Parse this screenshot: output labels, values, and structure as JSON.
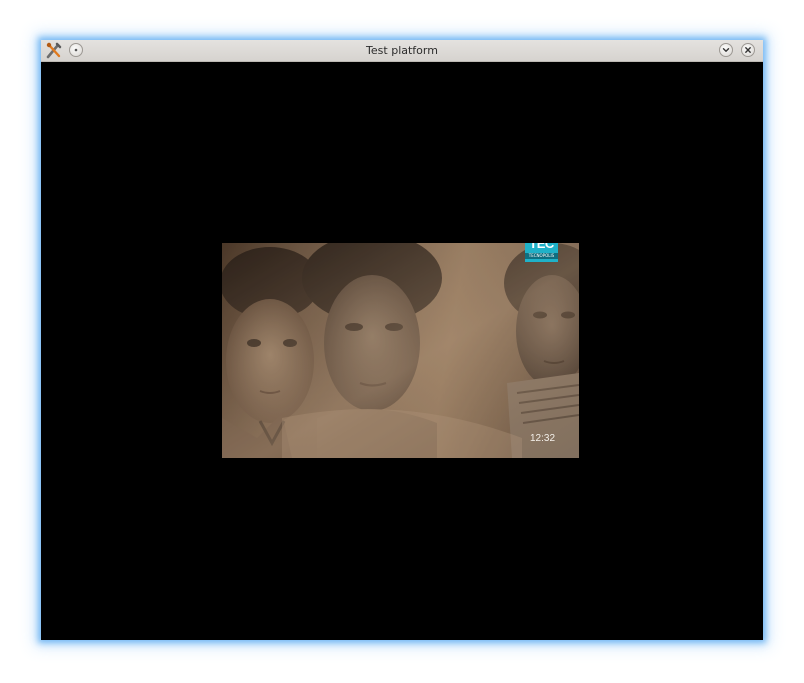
{
  "window": {
    "title": "Test platform"
  },
  "titlebar": {
    "app_icon": "tools-icon",
    "menu_button_icon": "dot-icon",
    "minimize_button_icon": "chevron-down-icon",
    "close_button_icon": "close-icon"
  },
  "video": {
    "channel_logo_text": "TEC",
    "channel_logo_subtext": "TECNOPOLIS",
    "clock": "12:32",
    "logo_color": "#1fb1c8"
  }
}
